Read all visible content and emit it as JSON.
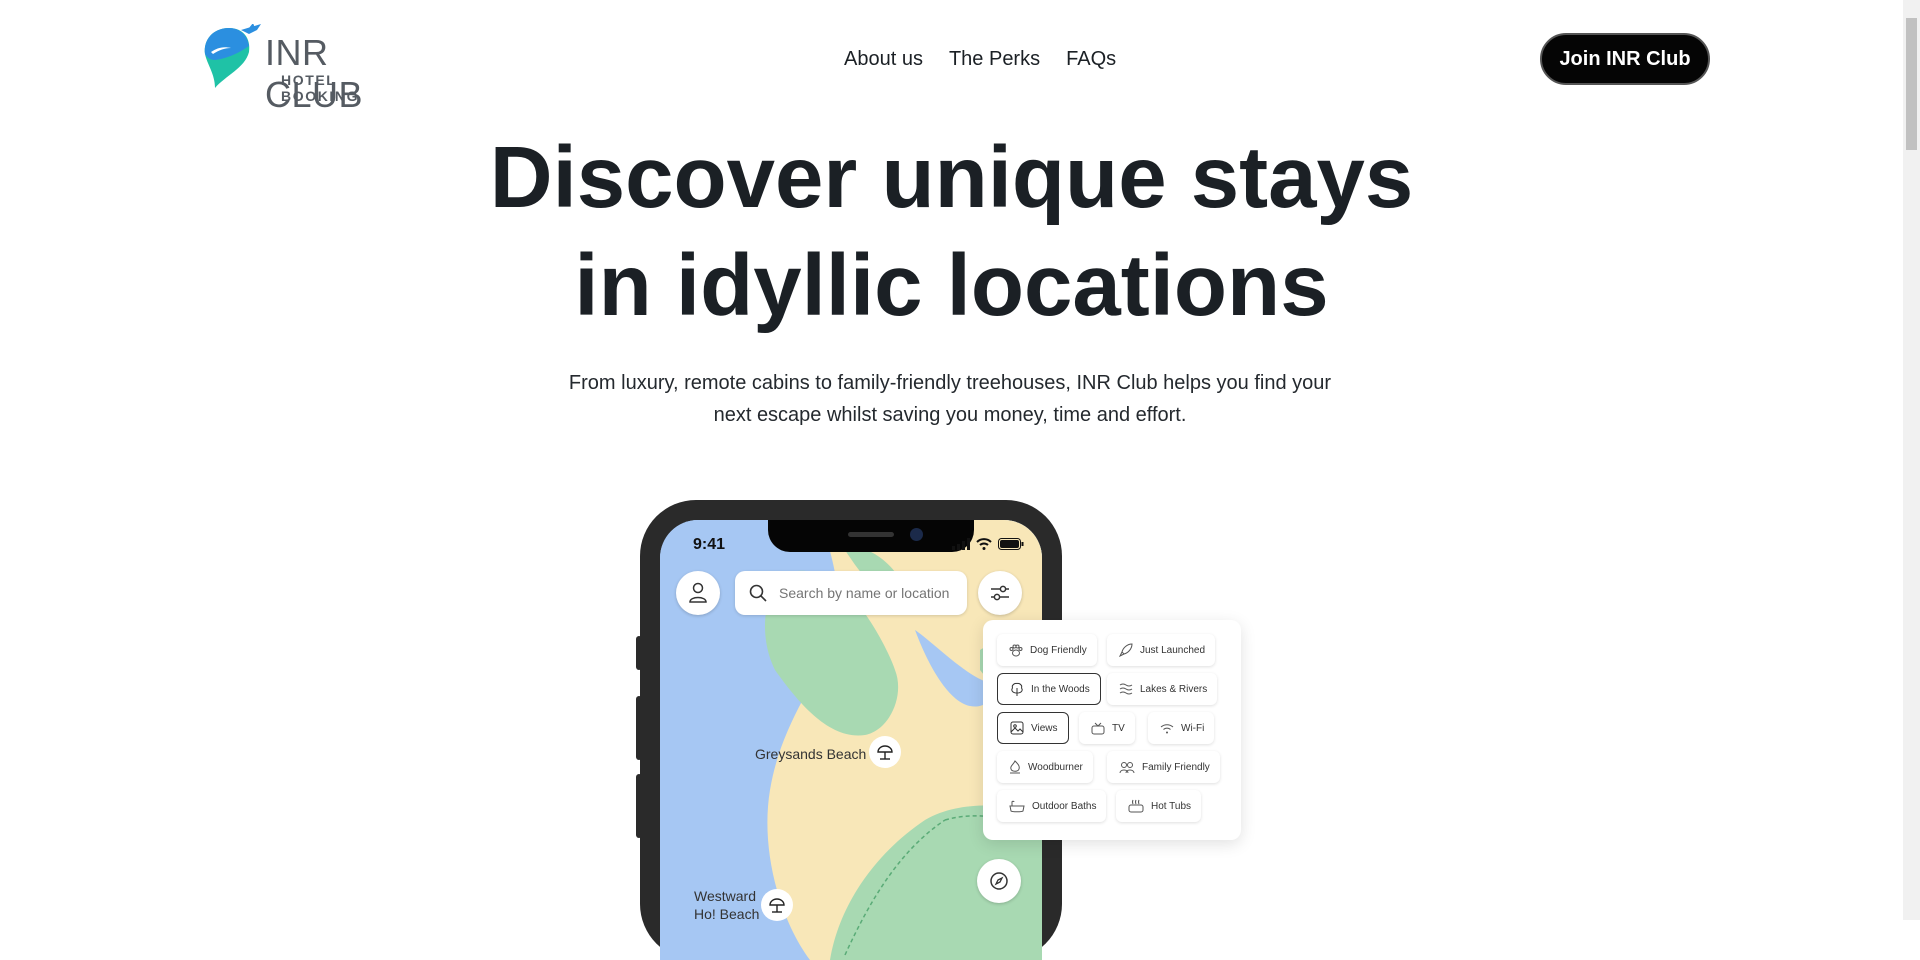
{
  "header": {
    "logo": {
      "brand": "INR CLUB",
      "subtitle": "HOTEL BOOKING",
      "icon": "map-pin-plane-icon"
    },
    "nav": [
      {
        "label": "About us"
      },
      {
        "label": "The Perks"
      },
      {
        "label": "FAQs"
      }
    ],
    "cta_label": "Join INR Club"
  },
  "hero": {
    "title_line1": "Discover unique stays",
    "title_line2": "in idyllic locations",
    "subtitle_line1": "From luxury, remote cabins to family-friendly treehouses, INR Club helps you find your",
    "subtitle_line2": "next escape whilst saving you money, time and effort."
  },
  "phone": {
    "time": "9:41",
    "search_placeholder": "Search by name or location",
    "icons": [
      "user-icon",
      "search-icon",
      "sliders-icon",
      "compass-icon",
      "umbrella-icon",
      "signal-icon",
      "wifi-icon",
      "battery-icon"
    ],
    "map_labels": {
      "greysands": "Greysands Beach",
      "westward_line1": "Westward",
      "westward_line2": "Ho! Beach"
    }
  },
  "filters": [
    {
      "label": "Dog Friendly",
      "icon": "paw-icon",
      "selected": false
    },
    {
      "label": "Just Launched",
      "icon": "rocket-icon",
      "selected": false
    },
    {
      "label": "In the Woods",
      "icon": "tree-icon",
      "selected": true
    },
    {
      "label": "Lakes & Rivers",
      "icon": "waves-icon",
      "selected": false
    },
    {
      "label": "Views",
      "icon": "image-icon",
      "selected": true
    },
    {
      "label": "TV",
      "icon": "tv-icon",
      "selected": false
    },
    {
      "label": "Wi-Fi",
      "icon": "wifi-icon",
      "selected": false
    },
    {
      "label": "Woodburner",
      "icon": "fire-icon",
      "selected": false
    },
    {
      "label": "Family Friendly",
      "icon": "family-icon",
      "selected": false
    },
    {
      "label": "Outdoor Baths",
      "icon": "bath-icon",
      "selected": false
    },
    {
      "label": "Hot Tubs",
      "icon": "hot-tub-icon",
      "selected": false
    }
  ],
  "colors": {
    "text": "#1b2025",
    "cta_bg": "#050505",
    "map_water": "#a6c7f3",
    "map_sand": "#f8e7b8",
    "map_green": "#a8d9b2",
    "logo_blue": "#2b8fe0",
    "logo_teal": "#1fc2a6"
  }
}
